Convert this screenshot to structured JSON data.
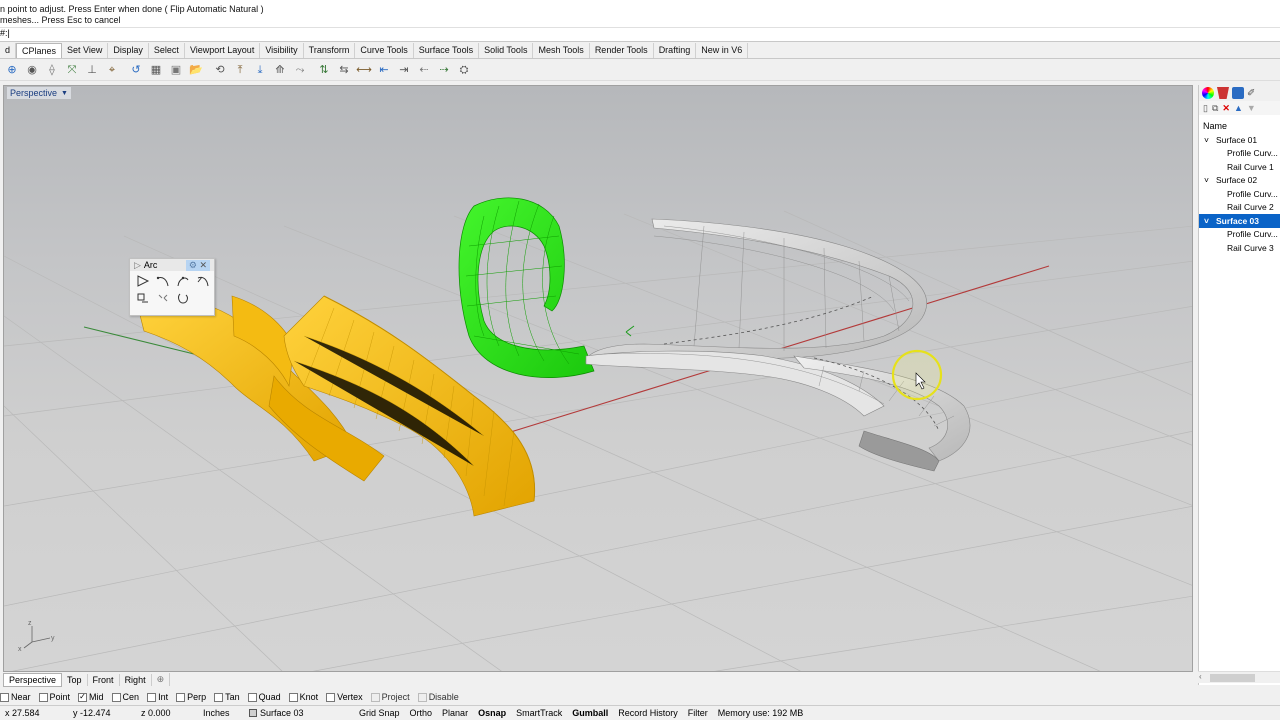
{
  "command": {
    "history": [
      "n point to adjust. Press Enter when done ( Flip  Automatic  Natural )",
      "meshes... Press Esc to cancel"
    ],
    "prompt": "#:"
  },
  "tabs": [
    "d",
    "CPlanes",
    "Set View",
    "Display",
    "Select",
    "Viewport Layout",
    "Visibility",
    "Transform",
    "Curve Tools",
    "Surface Tools",
    "Solid Tools",
    "Mesh Tools",
    "Render Tools",
    "Drafting",
    "New in V6"
  ],
  "active_tab": "CPlanes",
  "toolbar_icons": [
    "cplane-world-icon",
    "cplane-origin-icon",
    "cplane-3pt-icon",
    "cplane-xaxis-icon",
    "cplane-zaxis-icon",
    "cplane-object-icon",
    "cplane-curve-icon",
    "cplane-surface-icon",
    "cplane-view-icon",
    "cplane-elevation-icon",
    "cplane-undo-icon",
    "cplane-grid-icon",
    "cplane-save-icon",
    "cplane-open-icon",
    "cplane-rotate-icon",
    "cplane-top-icon",
    "cplane-front-icon",
    "cplane-right-icon",
    "cplane-back-icon",
    "cplane-left-icon",
    "cplane-prev-icon",
    "cplane-next-icon",
    "cplane-named-icon"
  ],
  "viewport": {
    "label": "Perspective",
    "axis_labels": {
      "z": "z",
      "y": "y",
      "x": "x"
    }
  },
  "arc_panel": {
    "title": "Arc"
  },
  "viewport_tabs": [
    "Perspective",
    "Top",
    "Front",
    "Right"
  ],
  "active_viewport_tab": "Perspective",
  "add_tab_icon": "plus-icon",
  "osnaps": [
    {
      "label": "Near",
      "checked": false,
      "disabled": false
    },
    {
      "label": "Point",
      "checked": false,
      "disabled": false
    },
    {
      "label": "Mid",
      "checked": true,
      "disabled": false
    },
    {
      "label": "Cen",
      "checked": false,
      "disabled": false
    },
    {
      "label": "Int",
      "checked": false,
      "disabled": false
    },
    {
      "label": "Perp",
      "checked": false,
      "disabled": false
    },
    {
      "label": "Tan",
      "checked": false,
      "disabled": false
    },
    {
      "label": "Quad",
      "checked": false,
      "disabled": false
    },
    {
      "label": "Knot",
      "checked": false,
      "disabled": false
    },
    {
      "label": "Vertex",
      "checked": false,
      "disabled": false
    },
    {
      "label": "Project",
      "checked": false,
      "disabled": true
    },
    {
      "label": "Disable",
      "checked": false,
      "disabled": true
    }
  ],
  "status": {
    "x": "x 27.584",
    "y": "y -12.474",
    "z": "z 0.000",
    "units": "Inches",
    "layer": "Surface 03",
    "buttons": [
      {
        "label": "Grid Snap",
        "bold": false
      },
      {
        "label": "Ortho",
        "bold": false
      },
      {
        "label": "Planar",
        "bold": false
      },
      {
        "label": "Osnap",
        "bold": true
      },
      {
        "label": "SmartTrack",
        "bold": false
      },
      {
        "label": "Gumball",
        "bold": true
      },
      {
        "label": "Record History",
        "bold": false
      },
      {
        "label": "Filter",
        "bold": false
      }
    ],
    "memory": "Memory use: 192 MB"
  },
  "layers": {
    "header": "Name",
    "rows": [
      {
        "label": "Surface 01",
        "indent": 1,
        "chevron": "˅",
        "selected": false
      },
      {
        "label": "Profile Curv...",
        "indent": 2,
        "chevron": "",
        "selected": false
      },
      {
        "label": "Rail Curve 1",
        "indent": 2,
        "chevron": "",
        "selected": false
      },
      {
        "label": "Surface  02",
        "indent": 1,
        "chevron": "˅",
        "selected": false
      },
      {
        "label": "Profile Curv...",
        "indent": 2,
        "chevron": "",
        "selected": false
      },
      {
        "label": "Rail Curve 2",
        "indent": 2,
        "chevron": "",
        "selected": false
      },
      {
        "label": "Surface  03",
        "indent": 1,
        "chevron": "˅",
        "selected": true
      },
      {
        "label": "Profile Curv...",
        "indent": 2,
        "chevron": "",
        "selected": false
      },
      {
        "label": "Rail Curve 3",
        "indent": 2,
        "chevron": "",
        "selected": false
      }
    ]
  },
  "colors": {
    "gold": "#f2b400",
    "green": "#22e010",
    "gray_surface": "#d9d9d9",
    "selection": "#0a63c7"
  }
}
